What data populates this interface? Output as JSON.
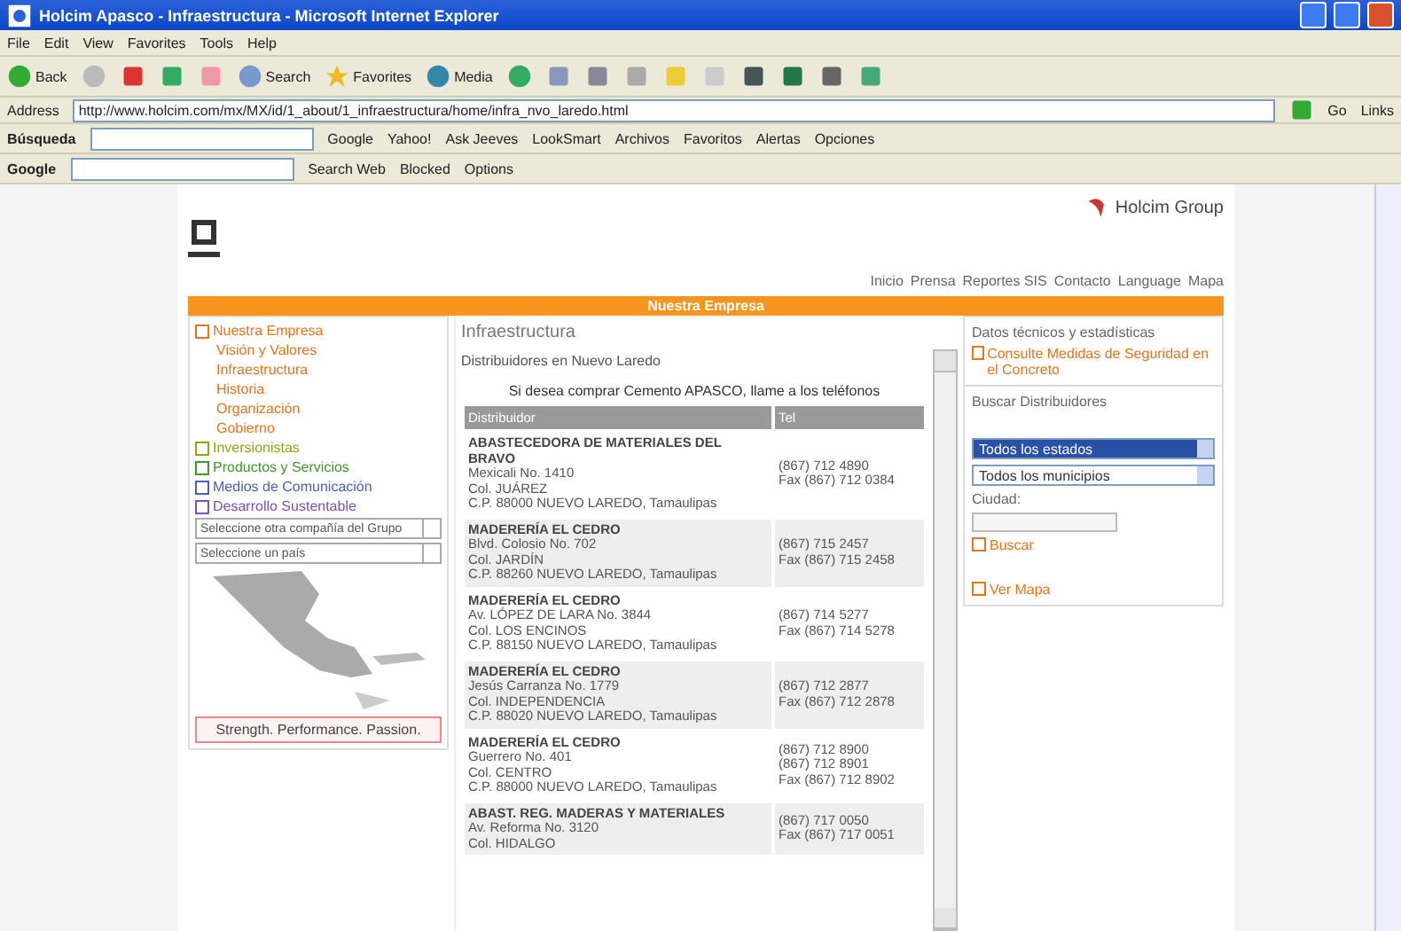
{
  "window": {
    "title": "Holcim Apasco - Infraestructura - Microsoft Internet Explorer"
  },
  "menu_bar": [
    "File",
    "Edit",
    "View",
    "Favorites",
    "Tools",
    "Help"
  ],
  "toolbar": {
    "back": "Back",
    "search": "Search",
    "favorites": "Favorites",
    "media": "Media"
  },
  "address_bar": {
    "label": "Address",
    "url": "http://www.holcim.com/mx/MX/id/1_about/1_infraestructura/home/infra_nvo_laredo.html",
    "go": "Go",
    "links": "Links"
  },
  "search_toolbar": {
    "label": "Búsqueda",
    "items": [
      "Google",
      "Yahoo!",
      "Ask Jeeves",
      "LookSmart",
      "Archivos",
      "Favoritos",
      "Alertas",
      "Opciones"
    ]
  },
  "google_toolbar": {
    "label": "Google",
    "items": [
      "Search Web",
      "Blocked",
      "Options"
    ]
  },
  "page": {
    "header": {
      "brand": "Holcim Group",
      "nav": [
        "Inicio",
        "Prensa",
        "Reportes SIS",
        "Contacto",
        "Language",
        "Mapa"
      ]
    },
    "section_title": "Nuestra Empresa",
    "sidebar": {
      "sections": [
        {
          "label": "Nuestra Empresa",
          "color": "#e8741c",
          "children": [
            {
              "label": "Visión y Valores"
            },
            {
              "label": "Infraestructura"
            },
            {
              "label": "Historia"
            },
            {
              "label": "Organización"
            },
            {
              "label": "Gobierno"
            }
          ]
        },
        {
          "label": "Inversionistas",
          "color": "#8aa817"
        },
        {
          "label": "Productos y Servicios",
          "color": "#3d9a2b"
        },
        {
          "label": "Medios de Comunicación",
          "color": "#4a5fc0"
        },
        {
          "label": "Desarrollo Sustentable",
          "color": "#7a4fc0"
        }
      ],
      "selects": [
        "Seleccione otra compañía del Grupo",
        "Seleccione un país"
      ],
      "tagline": "Strength. Performance. Passion."
    },
    "content": {
      "heading": "Infraestructura",
      "subheading": "Distribuidores en Nuevo Laredo",
      "note": "Si desea comprar Cemento APASCO, llame a los teléfonos",
      "columns": [
        "Distribuidor",
        "Tel"
      ],
      "rows": [
        {
          "lines": [
            "ABASTECEDORA DE MATERIALES DEL BRAVO",
            "Mexicali No. 1410",
            "Col. JUÁREZ",
            "C.P. 88000 NUEVO LAREDO, Tamaulipas"
          ],
          "phones": [
            "(867) 712 4890",
            "Fax (867) 712 0384"
          ]
        },
        {
          "lines": [
            "MADERERÍA EL CEDRO",
            "Blvd. Colosio No. 702",
            "Col. JARDÍN",
            "C.P. 88260 NUEVO LAREDO, Tamaulipas"
          ],
          "phones": [
            "(867) 715 2457",
            "Fax (867) 715 2458"
          ]
        },
        {
          "lines": [
            "MADERERÍA EL CEDRO",
            "Av. LÓPEZ DE LARA No. 3844",
            "Col. LOS ENCINOS",
            "C.P. 88150 NUEVO LAREDO, Tamaulipas"
          ],
          "phones": [
            "(867) 714 5277",
            "Fax (867) 714 5278"
          ]
        },
        {
          "lines": [
            "MADERERÍA EL CEDRO",
            "Jesús Carranza No. 1779",
            "Col. INDEPENDENCIA",
            "C.P. 88020 NUEVO LAREDO, Tamaulipas"
          ],
          "phones": [
            "(867) 712 2877",
            "Fax (867) 712 2878"
          ]
        },
        {
          "lines": [
            "MADERERÍA EL CEDRO",
            "Guerrero No. 401",
            "Col. CENTRO",
            "C.P. 88000 NUEVO LAREDO, Tamaulipas"
          ],
          "phones": [
            "(867) 712 8900",
            "(867) 712 8901",
            "Fax (867) 712 8902"
          ]
        },
        {
          "lines": [
            "ABAST. REG. MADERAS Y MATERIALES",
            "Av. Reforma No. 3120",
            "Col. HIDALGO"
          ],
          "phones": [
            "(867) 717 0050",
            "Fax (867) 717 0051"
          ]
        }
      ]
    },
    "right_panel": {
      "title": "Datos técnicos y estadísticas",
      "link": "Consulte Medidas de Seguridad en el Concreto",
      "search_title": "Buscar Distribuidores",
      "selects": [
        {
          "label": "Todos los estados",
          "selected": true
        },
        {
          "label": "Todos los municipios",
          "selected": false
        }
      ],
      "city_label": "Ciudad:",
      "search_link": "Buscar",
      "map_link": "Ver Mapa"
    }
  }
}
